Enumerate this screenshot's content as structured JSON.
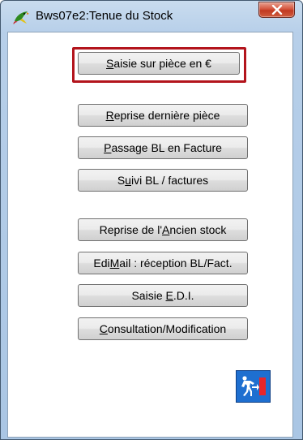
{
  "window": {
    "title": "Bws07e2:Tenue du Stock",
    "close_label": "X"
  },
  "buttons": [
    {
      "id": "saisie",
      "prefix": "",
      "accel": "S",
      "rest": "aisie sur pièce en €"
    },
    {
      "id": "reprise",
      "prefix": "",
      "accel": "R",
      "rest": "eprise dernière pièce"
    },
    {
      "id": "passage",
      "prefix": "",
      "accel": "P",
      "rest": "assage BL en Facture"
    },
    {
      "id": "suivi",
      "prefix": "S",
      "accel": "u",
      "rest": "ivi BL / factures"
    },
    {
      "id": "ancien",
      "prefix": "Reprise de l'",
      "accel": "A",
      "rest": "ncien stock"
    },
    {
      "id": "edimail",
      "prefix": "Edi",
      "accel": "M",
      "rest": "ail : réception BL/Fact."
    },
    {
      "id": "edi",
      "prefix": "Saisie ",
      "accel": "E",
      "rest": ".D.I."
    },
    {
      "id": "consultation",
      "prefix": "",
      "accel": "C",
      "rest": "onsultation/Modification"
    }
  ],
  "colors": {
    "highlight": "#b3141c",
    "exit_bg": "#1e6fd0",
    "exit_door": "#e8262a"
  },
  "icons": {
    "app": "parrot-icon",
    "close": "close-icon",
    "exit": "exit-door-icon"
  }
}
